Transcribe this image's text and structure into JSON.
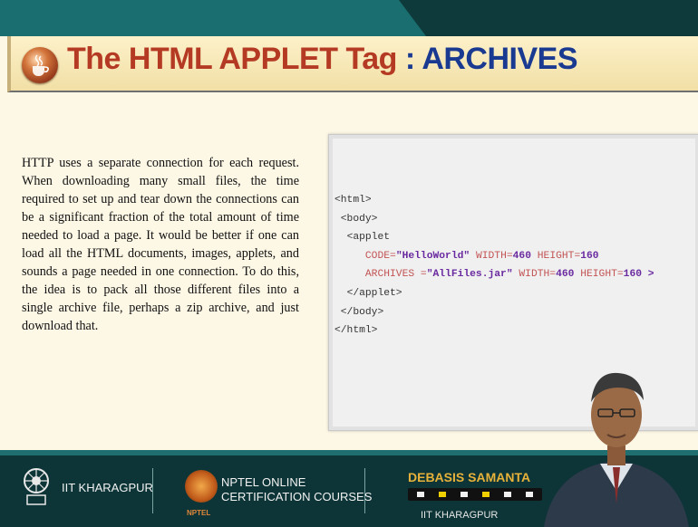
{
  "slide": {
    "title_part1": "The HTML APPLET Tag",
    "title_sep": " : ",
    "title_part2": "ARCHIVES",
    "paragraph": "HTTP uses a separate connection for each request. When downloading many small files, the time required to set up and tear down the connections can be a significant fraction of the total amount of time needed to load a page. It would be better if one can load all the HTML documents, images, applets, and sounds a page needed in one connection. To do this, the idea is to pack all those different files into a single archive file, perhaps a zip archive, and just download that.",
    "code": {
      "l1": "<html>",
      "l2": "<body>",
      "l3": "<applet",
      "l4_attr1": "CODE=",
      "l4_val1": "\"HelloWorld\"",
      "l4_attr2": " WIDTH=",
      "l4_val2": "460",
      "l4_attr3": " HEIGHT=",
      "l4_val3": "160",
      "l5_attr1": "ARCHIVES =",
      "l5_val1": "\"AllFiles.jar\"",
      "l5_attr2": " WIDTH=",
      "l5_val2": "460",
      "l5_attr3": " HEIGHT=",
      "l5_val3": "160",
      "l5_close": " >",
      "l6": "</applet>",
      "l7": "</body>",
      "l8": "</html>"
    }
  },
  "footer": {
    "iit_label": "IIT KHARAGPUR",
    "nptel_line1": "NPTEL ONLINE",
    "nptel_line2": "CERTIFICATION COURSES",
    "nptel_small": "NPTEL",
    "presenter_name": "DEBASIS SAMANTA",
    "presenter_org": "IIT KHARAGPUR"
  },
  "colors": {
    "title_red": "#b53a24",
    "title_blue": "#1a3a92",
    "footer_bg": "#0d3537",
    "presenter_gold": "#e8b23a"
  },
  "icons": {
    "title_icon": "java-cup-icon",
    "iit_logo": "iit-kharagpur-emblem",
    "nptel_logo": "nptel-emblem"
  }
}
